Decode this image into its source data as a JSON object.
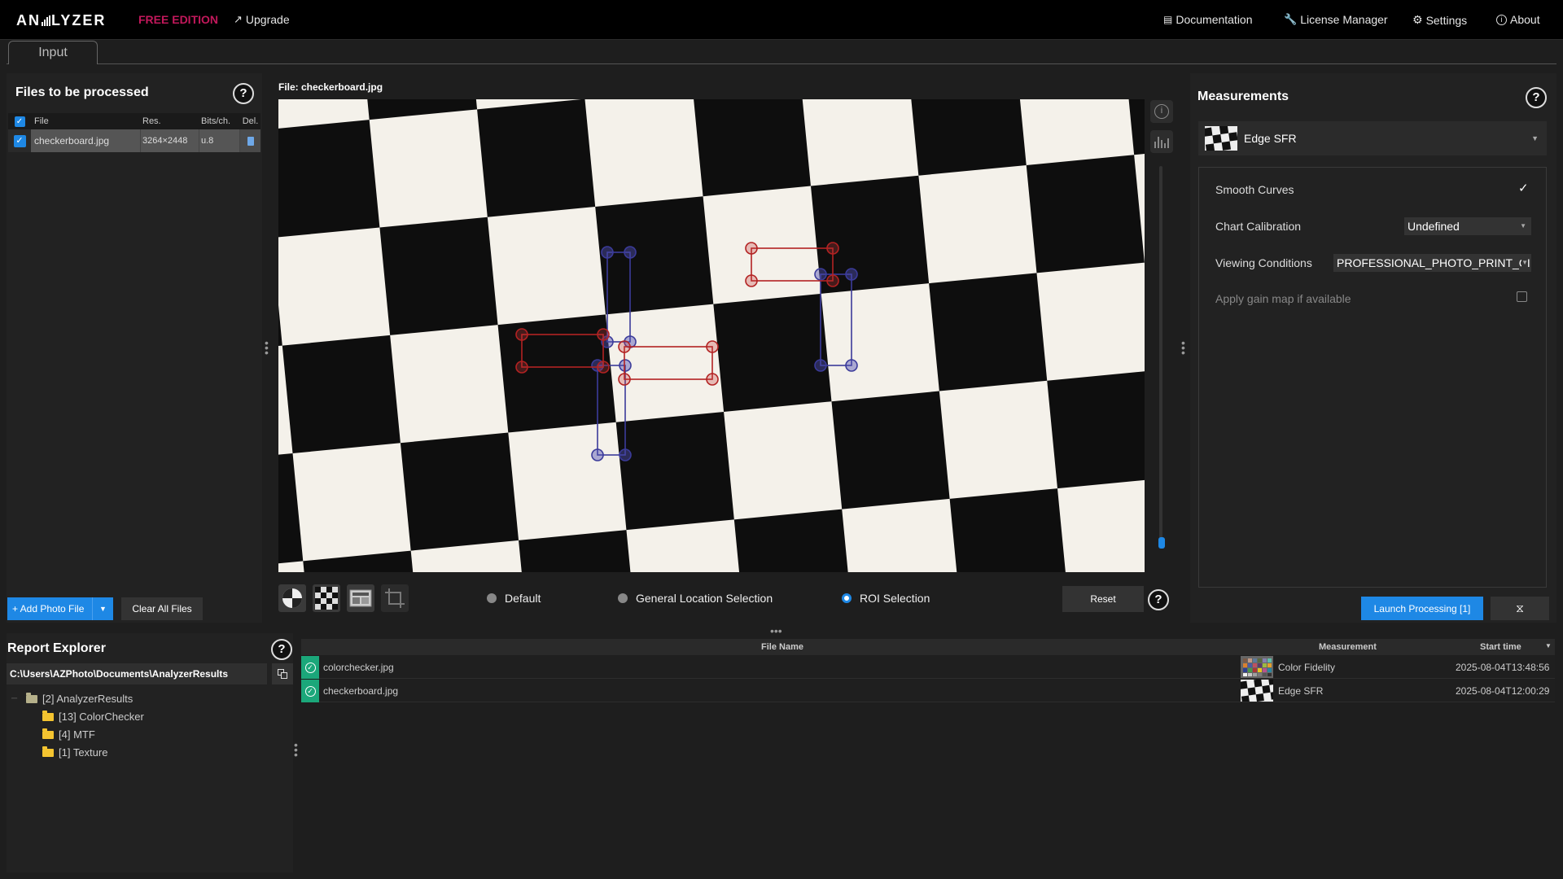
{
  "app": {
    "logo_left": "AN",
    "logo_right": "LYZER",
    "edition": "FREE EDITION",
    "upgrade": "Upgrade"
  },
  "nav": {
    "documentation": "Documentation",
    "license_manager": "License Manager",
    "settings": "Settings",
    "about": "About"
  },
  "tabs": {
    "input": "Input"
  },
  "files": {
    "title": "Files to be processed",
    "help": "?",
    "columns": {
      "file": "File",
      "res": "Res.",
      "bits": "Bits/ch.",
      "del": "Del."
    },
    "rows": [
      {
        "file": "checkerboard.jpg",
        "res": "3264×2448",
        "bits": "u.8"
      }
    ],
    "add_button": "+ Add Photo File",
    "clear_button": "Clear All Files"
  },
  "viewer": {
    "file_label": "File: checkerboard.jpg",
    "modes": [
      "Default",
      "General Location Selection",
      "ROI Selection"
    ],
    "selected_mode": "ROI Selection",
    "reset": "Reset",
    "help": "?"
  },
  "measurements": {
    "title": "Measurements",
    "help": "?",
    "selected": "Edge SFR",
    "options": {
      "smooth_curves": "Smooth Curves",
      "chart_calibration": "Chart Calibration",
      "chart_calibration_value": "Undefined",
      "viewing_conditions": "Viewing Conditions",
      "viewing_conditions_value": "PROFESSIONAL_PHOTO_PRINT_CI",
      "gain_map": "Apply gain map if available"
    },
    "launch": "Launch Processing  [1]"
  },
  "report": {
    "title": "Report Explorer",
    "help": "?",
    "path": "C:\\Users\\AZPhoto\\Documents\\AnalyzerResults",
    "tree": [
      {
        "label": "[2] AnalyzerResults"
      },
      {
        "label": "[13] ColorChecker"
      },
      {
        "label": "[4] MTF"
      },
      {
        "label": "[1] Texture"
      }
    ]
  },
  "results": {
    "columns": {
      "file_name": "File Name",
      "measurement": "Measurement",
      "start_time": "Start time"
    },
    "rows": [
      {
        "file": "colorchecker.jpg",
        "measurement": "Color Fidelity",
        "time": "2025-08-04T13:48:56"
      },
      {
        "file": "checkerboard.jpg",
        "measurement": "Edge SFR",
        "time": "2025-08-04T12:00:29"
      }
    ]
  },
  "colors": {
    "accent": "#1e88e5",
    "edition": "#c2185b",
    "ok": "#1ba77a",
    "roi_red": "#b22222",
    "roi_blue": "#3b3b9a"
  }
}
